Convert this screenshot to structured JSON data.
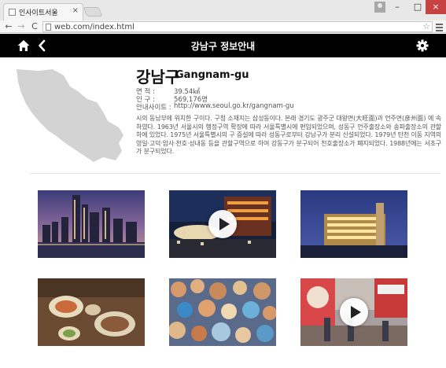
{
  "browser": {
    "tab_title": "인사이트서울",
    "tab_close": "×",
    "url": "web.com/index.html",
    "window_controls": {
      "minimize": "–",
      "maximize": "□",
      "close": "×"
    },
    "nav": {
      "back": "←",
      "forward": "→",
      "reload": "C"
    },
    "star_icon": "☆"
  },
  "header": {
    "title": "강남구 정보안내",
    "icons": [
      "home-icon",
      "back-icon",
      "gear-icon"
    ]
  },
  "district": {
    "name_ko": "강남구",
    "name_en": "Gangnam-gu",
    "area_label": "면  적 :",
    "area_value": "39.54㎢",
    "population_label": "인  구 :",
    "population_value": "569,176명",
    "site_label": "안내사이트 :",
    "site_value": "http://www.seoul.go.kr/gangnam-gu",
    "description": "시의 동남부에 위치한 구이다. 구청 소재지는 삼성동이다. 본래 경기도 광주군 대왕면(大旺面)과 언주면(彦州面) 에 속하였다. 1963년 서울시의 행정구역 확장에 따라 서울특별시에 편입되었으며, 성동구 언주출장소와 송파출장소의 관할 하에 있었다. 1975년 서울특별시의 구 증설에 따라 성동구로부터 강남구가 분리 신설되었다. 1979년 탄천 이동 지역의 영일·고덕·암사·천호·성내동 등을 관할구역으로 하여 강동구가 분구되어 천호출장소가 폐지되었다. 1988년에는 서초구가 분구되었다."
  },
  "gallery": [
    {
      "kind": "photo",
      "subject": "city skyline at dusk"
    },
    {
      "kind": "video",
      "subject": "mall plaza at night"
    },
    {
      "kind": "photo",
      "subject": "lit building at night"
    },
    {
      "kind": "photo",
      "subject": "food spread on table"
    },
    {
      "kind": "photo",
      "subject": "crowd at water festival"
    },
    {
      "kind": "video",
      "subject": "shopping street"
    }
  ],
  "colors": {
    "header_bg": "#000000",
    "map_fill": "#d3d3d3",
    "play_bg": "#ffffff"
  }
}
